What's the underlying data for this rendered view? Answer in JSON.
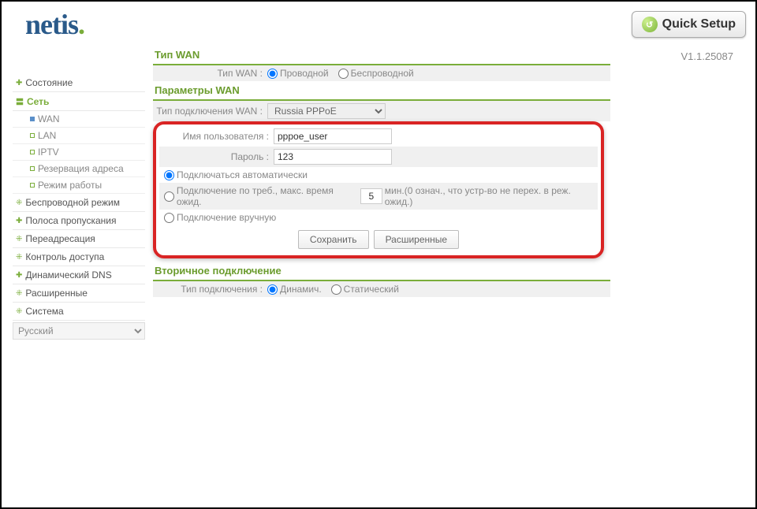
{
  "header": {
    "logo": "netis",
    "quick_setup": "Quick Setup"
  },
  "version": "V1.1.25087",
  "sidebar": {
    "items": [
      {
        "label": "Состояние",
        "type": "plus"
      },
      {
        "label": "Сеть",
        "type": "minus",
        "sel": true
      },
      {
        "label": "Беспроводной режим",
        "type": "plus2"
      },
      {
        "label": "Полоса пропускания",
        "type": "plus"
      },
      {
        "label": "Переадресация",
        "type": "plus2"
      },
      {
        "label": "Контроль доступа",
        "type": "plus2"
      },
      {
        "label": "Динамический DNS",
        "type": "plus"
      },
      {
        "label": "Расширенные",
        "type": "plus2"
      },
      {
        "label": "Система",
        "type": "plus2"
      }
    ],
    "subitems": [
      "WAN",
      "LAN",
      "IPTV",
      "Резервация адреса",
      "Режим работы"
    ],
    "language": "Русский"
  },
  "sections": {
    "wan_type": {
      "title": "Тип WAN",
      "label": "Тип WAN :",
      "opt1": "Проводной",
      "opt2": "Беспроводной"
    },
    "wan_params": {
      "title": "Параметры WAN",
      "conn_type_label": "Тип подключения WAN :",
      "conn_type_value": "Russia PPPoE",
      "user_label": "Имя пользователя :",
      "user_value": "pppoe_user",
      "pass_label": "Пароль :",
      "pass_value": "123",
      "auto": "Подключаться автоматически",
      "ondemand_pre": "Подключение по треб., макс. время ожид.",
      "ondemand_val": "5",
      "ondemand_post": "мин.(0 означ., что устр-во не перех. в реж. ожид.)",
      "manual": "Подключение вручную",
      "save": "Сохранить",
      "advanced": "Расширенные"
    },
    "secondary": {
      "title": "Вторичное подключение",
      "label": "Тип подключения :",
      "opt1": "Динамич.",
      "opt2": "Статический"
    }
  }
}
